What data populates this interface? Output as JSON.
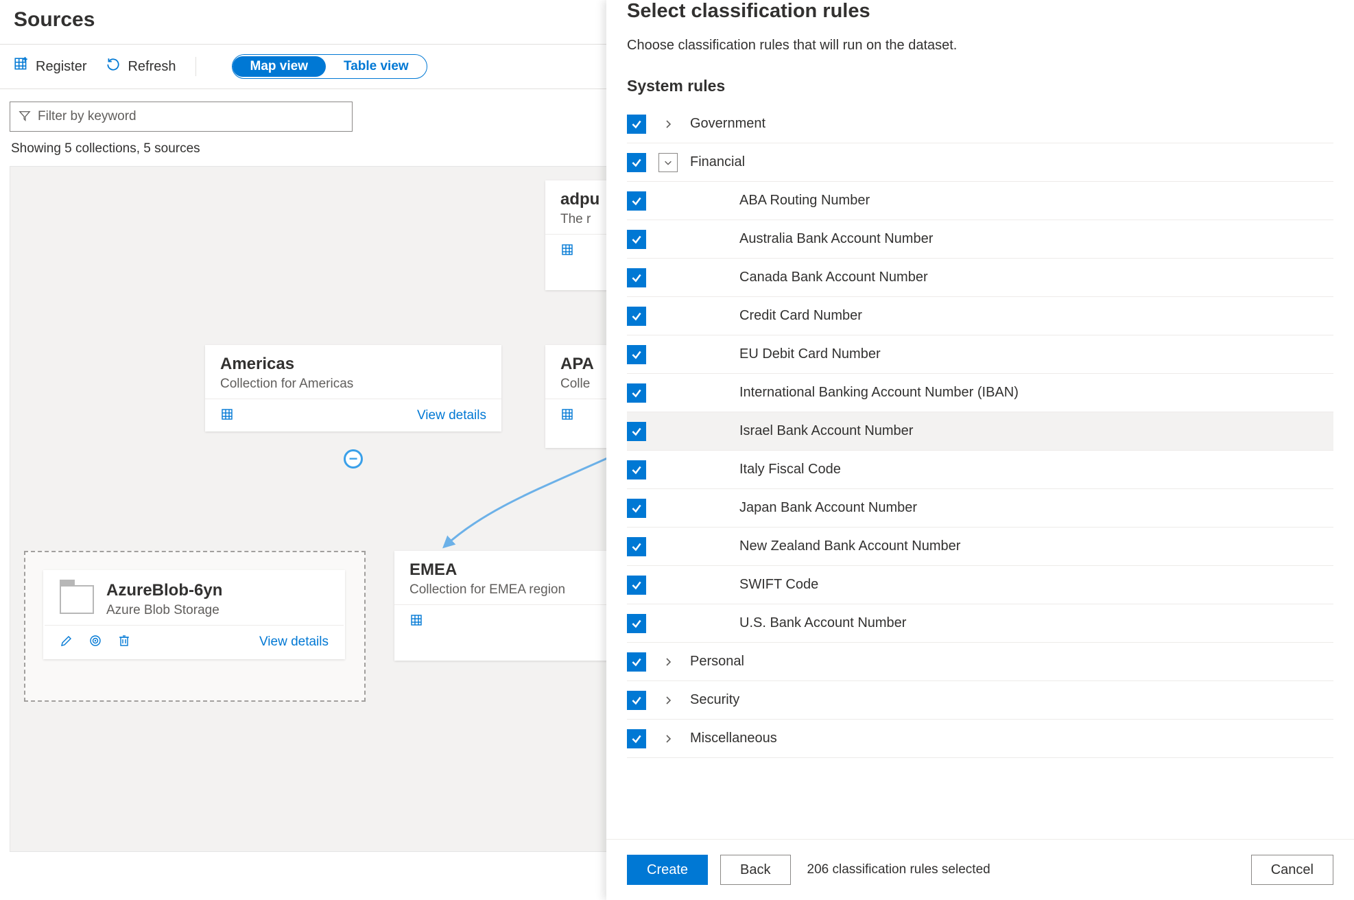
{
  "page": {
    "title": "Sources",
    "toolbar": {
      "register": "Register",
      "refresh": "Refresh"
    },
    "viewToggle": {
      "map": "Map view",
      "table": "Table view",
      "active": "map"
    },
    "filter": {
      "placeholder": "Filter by keyword"
    },
    "countLine": "Showing 5 collections, 5 sources",
    "cards": {
      "root": {
        "title": "adpu",
        "subtitle": "The r"
      },
      "americas": {
        "title": "Americas",
        "subtitle": "Collection for Americas",
        "viewDetails": "View details"
      },
      "apac": {
        "title": "APA",
        "subtitle": "Colle"
      },
      "emea": {
        "title": "EMEA",
        "subtitle": "Collection for EMEA region"
      },
      "source": {
        "title": "AzureBlob-6yn",
        "subtitle": "Azure Blob Storage",
        "viewDetails": "View details"
      }
    }
  },
  "panel": {
    "title": "Select classification rules",
    "description": "Choose classification rules that will run on the dataset.",
    "sectionTitle": "System rules",
    "groups": [
      {
        "id": "gov",
        "label": "Government",
        "expanded": false,
        "checked": true
      },
      {
        "id": "fin",
        "label": "Financial",
        "expanded": true,
        "checked": true,
        "children": [
          {
            "label": "ABA Routing Number",
            "checked": true,
            "highlight": false
          },
          {
            "label": "Australia Bank Account Number",
            "checked": true,
            "highlight": false
          },
          {
            "label": "Canada Bank Account Number",
            "checked": true,
            "highlight": false
          },
          {
            "label": "Credit Card Number",
            "checked": true,
            "highlight": false
          },
          {
            "label": "EU Debit Card Number",
            "checked": true,
            "highlight": false
          },
          {
            "label": "International Banking Account Number (IBAN)",
            "checked": true,
            "highlight": false
          },
          {
            "label": "Israel Bank Account Number",
            "checked": true,
            "highlight": true
          },
          {
            "label": "Italy Fiscal Code",
            "checked": true,
            "highlight": false
          },
          {
            "label": "Japan Bank Account Number",
            "checked": true,
            "highlight": false
          },
          {
            "label": "New Zealand Bank Account Number",
            "checked": true,
            "highlight": false
          },
          {
            "label": "SWIFT Code",
            "checked": true,
            "highlight": false
          },
          {
            "label": "U.S. Bank Account Number",
            "checked": true,
            "highlight": false
          }
        ]
      },
      {
        "id": "pers",
        "label": "Personal",
        "expanded": false,
        "checked": true
      },
      {
        "id": "sec",
        "label": "Security",
        "expanded": false,
        "checked": true
      },
      {
        "id": "misc",
        "label": "Miscellaneous",
        "expanded": false,
        "checked": true
      }
    ],
    "footer": {
      "create": "Create",
      "back": "Back",
      "status": "206 classification rules selected",
      "cancel": "Cancel"
    }
  }
}
